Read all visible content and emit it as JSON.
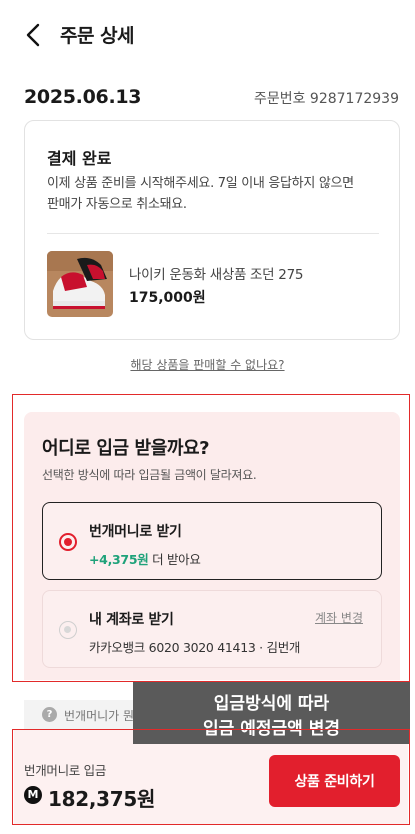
{
  "header": {
    "title": "주문 상세",
    "back_icon": "chevron-left-icon"
  },
  "order": {
    "date": "2025.06.13",
    "number_text": "주문번호 9287172939"
  },
  "status_card": {
    "title": "결제 완료",
    "description": "이제 상품 준비를 시작해주세요. 7일 이내 응답하지 않으면 판매가 자동으로 취소돼요.",
    "product_name": "나이키 운동화 새상품 조던 275",
    "product_price": "175,000원"
  },
  "cannot_sell_link": "해당 상품을 판매할 수 없나요?",
  "deposit": {
    "title": "어디로 입금 받을까요?",
    "subtitle": "선택한 방식에 따라 입금될 금액이 달라져요.",
    "options": [
      {
        "title": "번개머니로 받기",
        "bonus": "+4,375원",
        "bonus_suffix": " 더 받아요",
        "selected": true
      },
      {
        "title": "내 계좌로 받기",
        "account": "카카오뱅크 6020 3020 41413 · 김번개",
        "change_label": "계좌 변경",
        "selected": false
      }
    ]
  },
  "notice": {
    "text": "번개머니가 뭔가요?"
  },
  "overlay_label": {
    "line1": "입금방식에 따라",
    "line2": "입금 예정금액 변경"
  },
  "bottom_bar": {
    "label": "번개머니로 입금",
    "coin_symbol": "M",
    "amount": "182,375원",
    "button_label": "상품 준비하기"
  },
  "colors": {
    "accent": "#e21f2d",
    "bonus_green": "#1fa27a",
    "annotation_red": "#e22a2a",
    "panel_bg": "#fcecec"
  }
}
